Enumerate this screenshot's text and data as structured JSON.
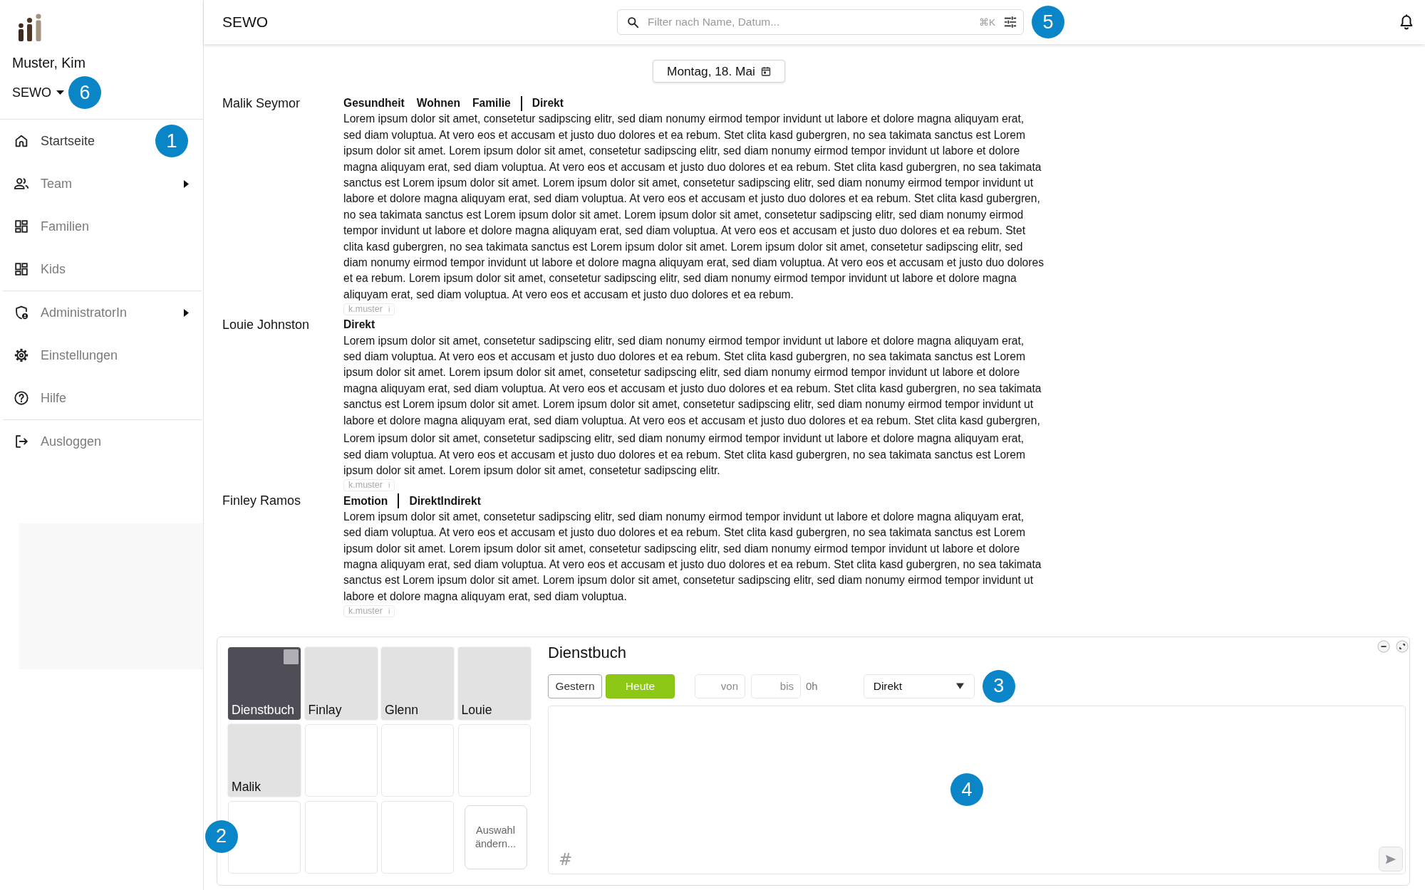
{
  "sidebar": {
    "user_name": "Muster, Kim",
    "organization": {
      "label": "SEWO",
      "callout": "6"
    },
    "nav_groups": [
      [
        {
          "label": "Startseite",
          "selected": true,
          "submenu": false,
          "callout": "1"
        },
        {
          "label": "Team",
          "selected": false,
          "submenu": true
        },
        {
          "label": "Familien",
          "selected": false,
          "submenu": false
        },
        {
          "label": "Kids",
          "selected": false,
          "submenu": false
        }
      ],
      [
        {
          "label": "AdministratorIn",
          "selected": false,
          "submenu": true
        },
        {
          "label": "Einstellungen",
          "selected": false,
          "submenu": false
        },
        {
          "label": "Hilfe",
          "selected": false,
          "submenu": false
        }
      ],
      [
        {
          "label": "Ausloggen",
          "selected": false,
          "submenu": false
        }
      ]
    ]
  },
  "topbar": {
    "title": "SEWO",
    "search": {
      "placeholder": "Filter nach Name, Datum...",
      "shortcut": "⌘K",
      "callout": "5"
    }
  },
  "date_button": {
    "label": "Montag, 18. Mai"
  },
  "entries": [
    {
      "name": "Malik Seymor",
      "categories": [
        "Gesundheit",
        "Wohnen",
        "Familie"
      ],
      "contact_type": "Direkt",
      "paragraphs": [
        "Lorem ipsum dolor sit amet, consetetur sadipscing elitr, sed diam nonumy eirmod tempor invidunt ut labore et dolore magna aliquyam erat, sed diam voluptua. At vero eos et accusam et justo duo dolores et ea rebum. Stet clita kasd gubergren, no sea takimata sanctus est Lorem ipsum dolor sit amet. Lorem ipsum dolor sit amet, consetetur sadipscing elitr, sed diam nonumy eirmod tempor invidunt ut labore et dolore magna aliquyam erat, sed diam voluptua. At vero eos et accusam et justo duo dolores et ea rebum. Stet clita kasd gubergren, no sea takimata sanctus est Lorem ipsum dolor sit amet. Lorem ipsum dolor sit amet, consetetur sadipscing elitr, sed diam nonumy eirmod tempor invidunt ut labore et dolore magna aliquyam erat, sed diam voluptua. At vero eos et accusam et justo duo dolores et ea rebum. Stet clita kasd gubergren, no sea takimata sanctus est Lorem ipsum dolor sit amet. Lorem ipsum dolor sit amet, consetetur sadipscing elitr, sed diam nonumy eirmod tempor invidunt ut labore et dolore magna aliquyam erat, sed diam voluptua. At vero eos et accusam et justo duo dolores et ea rebum. Stet clita kasd gubergren, no sea takimata sanctus est Lorem ipsum dolor sit amet. Lorem ipsum dolor sit amet, consetetur sadipscing elitr, sed diam nonumy eirmod tempor invidunt ut labore et dolore magna aliquyam erat, sed diam voluptua. At vero eos et accusam et justo duo dolores et ea rebum. Lorem ipsum dolor sit amet, consetetur sadipscing elitr, sed diam nonumy eirmod tempor invidunt ut labore et dolore magna aliquyam erat, sed diam voluptua. At vero eos et accusam et justo duo dolores et ea rebum."
      ],
      "author": "k.muster",
      "info": "i"
    },
    {
      "name": "Louie Johnston",
      "contact_type": "Direkt",
      "paragraphs": [
        "Lorem ipsum dolor sit amet, consetetur sadipscing elitr, sed diam nonumy eirmod tempor invidunt ut labore et dolore magna aliquyam erat, sed diam voluptua. At vero eos et accusam et justo duo dolores et ea rebum. Stet clita kasd gubergren, no sea takimata sanctus est Lorem ipsum dolor sit amet. Lorem ipsum dolor sit amet, consetetur sadipscing elitr, sed diam nonumy eirmod tempor invidunt ut labore et dolore magna aliquyam erat, sed diam voluptua. At vero eos et accusam et justo duo dolores et ea rebum. Stet clita kasd gubergren, no sea takimata sanctus est Lorem ipsum dolor sit amet. Lorem ipsum dolor sit amet, consetetur sadipscing elitr, sed diam nonumy eirmod tempor invidunt ut labore et dolore magna aliquyam erat, sed diam voluptua. At vero eos et accusam et justo duo dolores et ea rebum. Stet clita kasd gubergren,",
        "Lorem ipsum dolor sit amet, consetetur sadipscing elitr, sed diam nonumy eirmod tempor invidunt ut labore et dolore magna aliquyam erat, sed diam voluptua. At vero eos et accusam et justo duo dolores et ea rebum. Stet clita kasd gubergren, no sea takimata sanctus est Lorem ipsum dolor sit amet. Lorem ipsum dolor sit amet, consetetur sadipscing elitr."
      ],
      "author": "k.muster",
      "info": "i"
    },
    {
      "name": "Finley Ramos",
      "categories": [
        "Emotion"
      ],
      "contact_type": "DirektIndirekt",
      "paragraphs": [
        "Lorem ipsum dolor sit amet, consetetur sadipscing elitr, sed diam nonumy eirmod tempor invidunt ut labore et dolore magna aliquyam erat, sed diam voluptua. At vero eos et accusam et justo duo dolores et ea rebum. Stet clita kasd gubergren, no sea takimata sanctus est Lorem ipsum dolor sit amet. Lorem ipsum dolor sit amet, consetetur sadipscing elitr, sed diam nonumy eirmod tempor invidunt ut labore et dolore magna aliquyam erat, sed diam voluptua. At vero eos et accusam et justo duo dolores et ea rebum. Stet clita kasd gubergren, no sea takimata sanctus est Lorem ipsum dolor sit amet. Lorem ipsum dolor sit amet, consetetur sadipscing elitr, sed diam nonumy eirmod tempor invidunt ut labore et dolore magna aliquyam erat, sed diam voluptua."
      ],
      "author": "k.muster",
      "info": "i"
    }
  ],
  "journal_panel": {
    "callout": "2",
    "tiles": [
      {
        "kind": "entry",
        "label": "Dienstbuch",
        "selected": true
      },
      {
        "kind": "entry",
        "label": "Finlay",
        "selected": false
      },
      {
        "kind": "entry",
        "label": "Glenn",
        "selected": false
      },
      {
        "kind": "entry",
        "label": "Louie",
        "selected": false
      },
      {
        "kind": "entry",
        "label": "Malik",
        "selected": false
      },
      {
        "kind": "empty",
        "selected": false
      },
      {
        "kind": "empty",
        "selected": false
      },
      {
        "kind": "empty",
        "selected": false
      },
      {
        "kind": "empty",
        "selected": false
      },
      {
        "kind": "empty",
        "selected": false
      },
      {
        "kind": "empty",
        "selected": false
      }
    ],
    "change_selection_button": "Auswahl ändern...",
    "title": "Dienstbuch",
    "day_buttons": [
      {
        "label": "Gestern",
        "selected": false
      },
      {
        "label": "Heute",
        "selected": true
      }
    ],
    "from_field": {
      "placeholder": "von"
    },
    "to_field": {
      "placeholder": "bis"
    },
    "duration": "0h",
    "contact_select": {
      "value": "Direkt",
      "callout": "3"
    },
    "message_field": {
      "hashtag_button": "#",
      "callout": "4"
    }
  }
}
